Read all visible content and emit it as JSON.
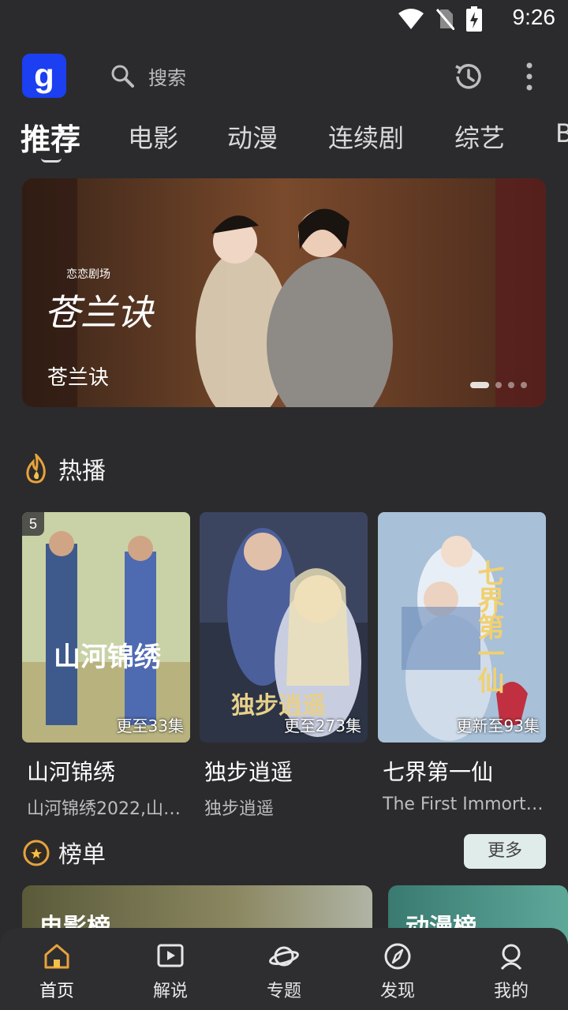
{
  "status": {
    "time": "9:26"
  },
  "search": {
    "placeholder": "搜索"
  },
  "tabs": [
    "推荐",
    "电影",
    "动漫",
    "连续剧",
    "综艺",
    "B"
  ],
  "banner": {
    "caption": "苍兰诀",
    "logo_text": "苍兰诀",
    "studio": "恋恋剧场"
  },
  "hot": {
    "title": "热播",
    "cards": [
      {
        "name": "山河锦绣",
        "sub": "山河锦绣2022,山…",
        "update": "更至33集",
        "rank": "5",
        "poster_title": "山河锦绣"
      },
      {
        "name": "独步逍遥",
        "sub": "独步逍遥",
        "update": "更至273集",
        "poster_title": "独步逍遥"
      },
      {
        "name": "七界第一仙",
        "sub": "The First Immort…",
        "update": "更新至93集",
        "poster_title": "七界第一仙"
      }
    ]
  },
  "ranking": {
    "title": "榜单",
    "more": "更多",
    "cards": [
      {
        "label": "电影榜"
      },
      {
        "label": "动漫榜"
      }
    ]
  },
  "nav": [
    {
      "label": "首页",
      "icon": "home-icon"
    },
    {
      "label": "解说",
      "icon": "video-icon"
    },
    {
      "label": "专题",
      "icon": "planet-icon"
    },
    {
      "label": "发现",
      "icon": "compass-icon"
    },
    {
      "label": "我的",
      "icon": "user-icon"
    }
  ],
  "colors": {
    "background": "#2b2b2d",
    "logo": "#1c3ff2",
    "accent": "#e8a33a"
  }
}
